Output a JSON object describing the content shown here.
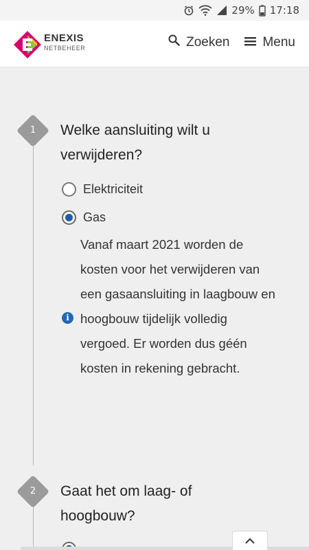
{
  "status_bar": {
    "battery_percent": "29%",
    "time": "17:18"
  },
  "header": {
    "brand_name": "ENEXIS",
    "brand_sub": "NETBEHEER",
    "search_label": "Zoeken",
    "menu_label": "Menu"
  },
  "steps": [
    {
      "number": "1",
      "question": "Welke aansluiting wilt u verwijderen?",
      "options": [
        {
          "label": "Elektriciteit",
          "checked": false
        },
        {
          "label": "Gas",
          "checked": true
        }
      ],
      "info": "Vanaf maart 2021 worden de kosten voor het verwijderen van een gasaansluiting in laagbouw en hoogbouw tijdelijk volledig vergoed. Er worden dus géén kosten in rekening gebracht."
    },
    {
      "number": "2",
      "question": "Gaat het om laag- of hoogbouw?"
    }
  ],
  "colors": {
    "accent_blue": "#1f5ca8",
    "badge_gray": "#9b9b9b",
    "logo_magenta": "#d6006f",
    "logo_green": "#8dc63f",
    "logo_yellow": "#f7c600"
  }
}
